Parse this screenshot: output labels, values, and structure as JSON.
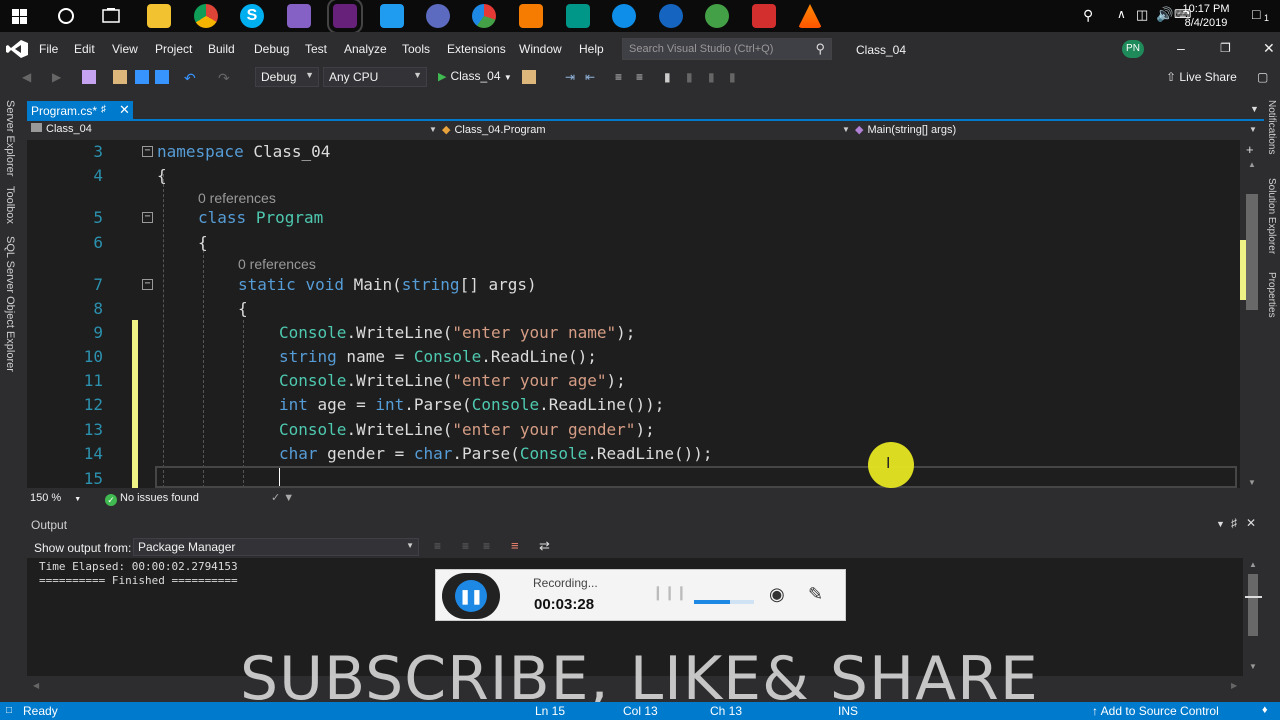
{
  "taskbar": {
    "clock_time": "10:17 PM",
    "clock_date": "8/4/2019",
    "notification_count": "1"
  },
  "menubar": {
    "items": [
      "File",
      "Edit",
      "View",
      "Project",
      "Build",
      "Debug",
      "Test",
      "Analyze",
      "Tools",
      "Extensions",
      "Window",
      "Help"
    ],
    "search_placeholder": "Search Visual Studio (Ctrl+Q)",
    "solution_name": "Class_04",
    "user_initials": "PN"
  },
  "toolbar": {
    "configuration": "Debug",
    "platform": "Any CPU",
    "run_target": "Class_04",
    "live_share": "Live Share"
  },
  "left_strip": [
    "Server Explorer",
    "Toolbox",
    "SQL Server Object Explorer"
  ],
  "right_strip": [
    "Notifications",
    "Solution Explorer",
    "Properties"
  ],
  "document_tab": {
    "label": "Program.cs*"
  },
  "navbar": {
    "project": "Class_04",
    "type": "Class_04.Program",
    "member": "Main(string[] args)"
  },
  "editor": {
    "code_lens": "0 references",
    "lines": [
      {
        "num": "3",
        "text": "namespace Class_04"
      },
      {
        "num": "4",
        "text": "{"
      },
      {
        "num": "5",
        "text": "class Program"
      },
      {
        "num": "6",
        "text": "{"
      },
      {
        "num": "7",
        "text": "static void Main(string[] args)"
      },
      {
        "num": "8",
        "text": "{"
      },
      {
        "num": "9",
        "text": "Console.WriteLine(\"enter your name\");"
      },
      {
        "num": "10",
        "text": "string name = Console.ReadLine();"
      },
      {
        "num": "11",
        "text": "Console.WriteLine(\"enter your age\");"
      },
      {
        "num": "12",
        "text": "int age = int.Parse(Console.ReadLine());"
      },
      {
        "num": "13",
        "text": "Console.WriteLine(\"enter your gender\");"
      },
      {
        "num": "14",
        "text": "char gender = char.Parse(Console.ReadLine());"
      },
      {
        "num": "15",
        "text": ""
      }
    ],
    "zoom": "150 %",
    "issues": "No issues found"
  },
  "output": {
    "title": "Output",
    "show_from_label": "Show output from:",
    "source": "Package Manager",
    "lines": [
      "Time Elapsed: 00:00:02.2794153",
      "========== Finished =========="
    ]
  },
  "recording": {
    "status": "Recording...",
    "elapsed": "00:03:28"
  },
  "banner": "SUBSCRIBE, LIKE& SHARE",
  "statusbar": {
    "state": "Ready",
    "line": "Ln 15",
    "col": "Col 13",
    "ch": "Ch 13",
    "mode": "INS",
    "source_control": "Add to Source Control"
  },
  "colors": {
    "accent": "#007acc",
    "keyword": "#569cd6",
    "type": "#4ec9b0",
    "string": "#d69d85",
    "line_number": "#2b91af",
    "change_marker": "#eff284"
  }
}
